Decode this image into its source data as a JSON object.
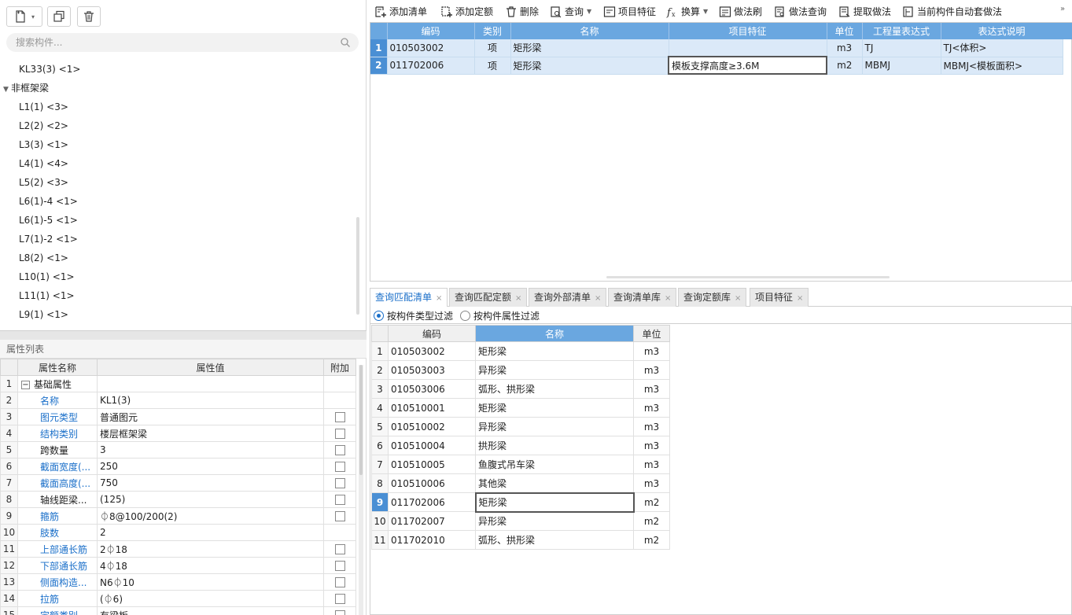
{
  "left": {
    "search_placeholder": "搜索构件...",
    "tree": [
      {
        "type": "leaf",
        "label": "KL33(3) <1>"
      },
      {
        "type": "group",
        "label": "非框架梁"
      },
      {
        "type": "leaf",
        "label": "L1(1) <3>"
      },
      {
        "type": "leaf",
        "label": "L2(2) <2>"
      },
      {
        "type": "leaf",
        "label": "L3(3) <1>"
      },
      {
        "type": "leaf",
        "label": "L4(1) <4>"
      },
      {
        "type": "leaf",
        "label": "L5(2) <3>"
      },
      {
        "type": "leaf",
        "label": "L6(1)-4 <1>"
      },
      {
        "type": "leaf",
        "label": "L6(1)-5 <1>"
      },
      {
        "type": "leaf",
        "label": "L7(1)-2 <1>"
      },
      {
        "type": "leaf",
        "label": "L8(2) <1>"
      },
      {
        "type": "leaf",
        "label": "L10(1) <1>"
      },
      {
        "type": "leaf",
        "label": "L11(1) <1>"
      },
      {
        "type": "leaf",
        "label": "L9(1) <1>"
      }
    ],
    "prop_title": "属性列表",
    "prop_headers": [
      "属性名称",
      "属性值",
      "附加"
    ],
    "props": [
      {
        "n": "1",
        "name": "基础属性",
        "value": "",
        "group": true,
        "blue": false,
        "chk": false
      },
      {
        "n": "2",
        "name": "名称",
        "value": "KL1(3)",
        "group": false,
        "blue": true,
        "chk": false
      },
      {
        "n": "3",
        "name": "图元类型",
        "value": "普通图元",
        "group": false,
        "blue": true,
        "chk": true
      },
      {
        "n": "4",
        "name": "结构类别",
        "value": "楼层框架梁",
        "group": false,
        "blue": true,
        "chk": true
      },
      {
        "n": "5",
        "name": "跨数量",
        "value": "3",
        "group": false,
        "blue": false,
        "chk": true
      },
      {
        "n": "6",
        "name": "截面宽度(...",
        "value": "250",
        "group": false,
        "blue": true,
        "chk": true
      },
      {
        "n": "7",
        "name": "截面高度(...",
        "value": "750",
        "group": false,
        "blue": true,
        "chk": true
      },
      {
        "n": "8",
        "name": "轴线距梁...",
        "value": "(125)",
        "group": false,
        "blue": false,
        "chk": true
      },
      {
        "n": "9",
        "name": "箍筋",
        "value": "⏀8@100/200(2)",
        "group": false,
        "blue": true,
        "chk": true
      },
      {
        "n": "10",
        "name": "肢数",
        "value": "2",
        "group": false,
        "blue": true,
        "chk": false
      },
      {
        "n": "11",
        "name": "上部通长筋",
        "value": "2⏀18",
        "group": false,
        "blue": true,
        "chk": true
      },
      {
        "n": "12",
        "name": "下部通长筋",
        "value": "4⏀18",
        "group": false,
        "blue": true,
        "chk": true
      },
      {
        "n": "13",
        "name": "侧面构造...",
        "value": "N6⏀10",
        "group": false,
        "blue": true,
        "chk": true
      },
      {
        "n": "14",
        "name": "拉筋",
        "value": "(⏀6)",
        "group": false,
        "blue": true,
        "chk": true
      },
      {
        "n": "15",
        "name": "定额类别",
        "value": "有梁板",
        "group": false,
        "blue": true,
        "chk": true
      }
    ]
  },
  "toolbar": [
    {
      "label": "添加清单",
      "icon": "add-list-icon",
      "dd": false
    },
    {
      "label": "添加定额",
      "icon": "add-quota-icon",
      "dd": false
    },
    {
      "label": "删除",
      "icon": "trash-icon",
      "dd": false
    },
    {
      "label": "查询",
      "icon": "query-icon",
      "dd": true
    },
    {
      "label": "项目特征",
      "icon": "feature-icon",
      "dd": false
    },
    {
      "label": "换算",
      "icon": "fx-icon",
      "dd": true
    },
    {
      "label": "做法刷",
      "icon": "brush-icon",
      "dd": false
    },
    {
      "label": "做法查询",
      "icon": "method-query-icon",
      "dd": false
    },
    {
      "label": "提取做法",
      "icon": "extract-icon",
      "dd": false
    },
    {
      "label": "当前构件自动套做法",
      "icon": "auto-apply-icon",
      "dd": false
    }
  ],
  "upper": {
    "headers": [
      "",
      "编码",
      "类别",
      "名称",
      "项目特征",
      "单位",
      "工程量表达式",
      "表达式说明"
    ],
    "rows": [
      {
        "n": "1",
        "code": "010503002",
        "cat": "项",
        "name": "矩形梁",
        "feature": "",
        "unit": "m3",
        "expr": "TJ",
        "desc": "TJ<体积>"
      },
      {
        "n": "2",
        "code": "011702006",
        "cat": "项",
        "name": "矩形梁",
        "feature": "模板支撑高度≥3.6M",
        "unit": "m2",
        "expr": "MBMJ",
        "desc": "MBMJ<模板面积>"
      }
    ]
  },
  "tabs": [
    "查询匹配清单",
    "查询匹配定额",
    "查询外部清单",
    "查询清单库",
    "查询定额库",
    "项目特征"
  ],
  "filters": [
    "按构件类型过滤",
    "按构件属性过滤"
  ],
  "lower": {
    "headers": [
      "",
      "编码",
      "名称",
      "单位"
    ],
    "rows": [
      {
        "n": "1",
        "code": "010503002",
        "name": "矩形梁",
        "unit": "m3"
      },
      {
        "n": "2",
        "code": "010503003",
        "name": "异形梁",
        "unit": "m3"
      },
      {
        "n": "3",
        "code": "010503006",
        "name": "弧形、拱形梁",
        "unit": "m3"
      },
      {
        "n": "4",
        "code": "010510001",
        "name": "矩形梁",
        "unit": "m3"
      },
      {
        "n": "5",
        "code": "010510002",
        "name": "异形梁",
        "unit": "m3"
      },
      {
        "n": "6",
        "code": "010510004",
        "name": "拱形梁",
        "unit": "m3"
      },
      {
        "n": "7",
        "code": "010510005",
        "name": "鱼腹式吊车梁",
        "unit": "m3"
      },
      {
        "n": "8",
        "code": "010510006",
        "name": "其他梁",
        "unit": "m3"
      },
      {
        "n": "9",
        "code": "011702006",
        "name": "矩形梁",
        "unit": "m2"
      },
      {
        "n": "10",
        "code": "011702007",
        "name": "异形梁",
        "unit": "m2"
      },
      {
        "n": "11",
        "code": "011702010",
        "name": "弧形、拱形梁",
        "unit": "m2"
      }
    ]
  }
}
